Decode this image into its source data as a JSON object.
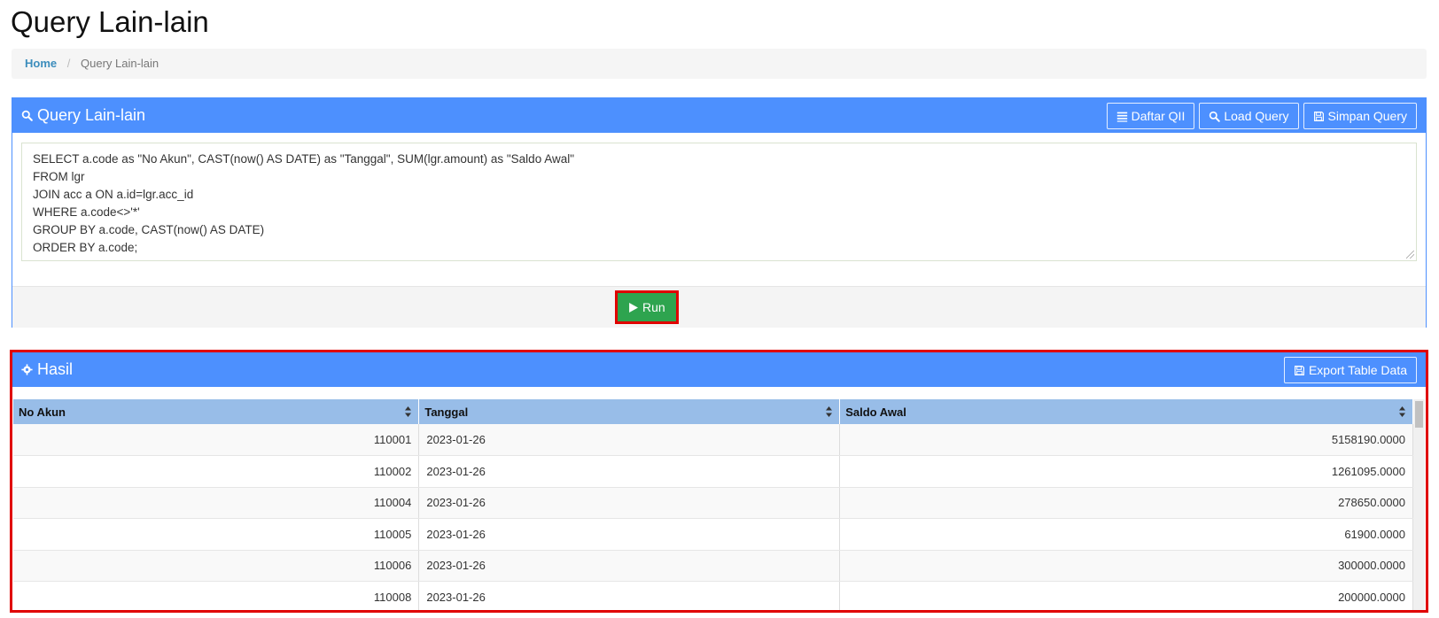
{
  "page": {
    "title": "Query Lain-lain"
  },
  "breadcrumb": {
    "home": "Home",
    "separator": "/",
    "current": "Query Lain-lain"
  },
  "query_panel": {
    "title": "Query Lain-lain",
    "buttons": {
      "daftar": "Daftar QII",
      "load": "Load Query",
      "simpan": "Simpan Query"
    },
    "sql_lines": [
      "SELECT a.code as \"No Akun\", CAST(now() AS DATE) as \"Tanggal\", SUM(lgr.amount) as \"Saldo Awal\"",
      "FROM lgr",
      "JOIN acc a ON a.id=lgr.acc_id",
      "WHERE a.code<>'*'",
      "GROUP BY a.code, CAST(now() AS DATE)",
      "ORDER BY a.code;"
    ],
    "run_label": "Run"
  },
  "result_panel": {
    "title": "Hasil",
    "export_label": "Export Table Data",
    "columns": [
      "No Akun",
      "Tanggal",
      "Saldo Awal"
    ],
    "rows": [
      [
        "110001",
        "2023-01-26",
        "5158190.0000"
      ],
      [
        "110002",
        "2023-01-26",
        "1261095.0000"
      ],
      [
        "110004",
        "2023-01-26",
        "278650.0000"
      ],
      [
        "110005",
        "2023-01-26",
        "61900.0000"
      ],
      [
        "110006",
        "2023-01-26",
        "300000.0000"
      ],
      [
        "110008",
        "2023-01-26",
        "200000.0000"
      ]
    ]
  },
  "colors": {
    "accent": "#4d90fe",
    "header_row": "#98bde8",
    "run_green": "#2ea44f",
    "highlight_red": "#e00000"
  },
  "icons": {
    "search": "search-icon",
    "list": "list-icon",
    "save": "floppy-disk-icon",
    "play": "play-icon",
    "gear": "gear-icon",
    "sort": "sort-icon"
  }
}
